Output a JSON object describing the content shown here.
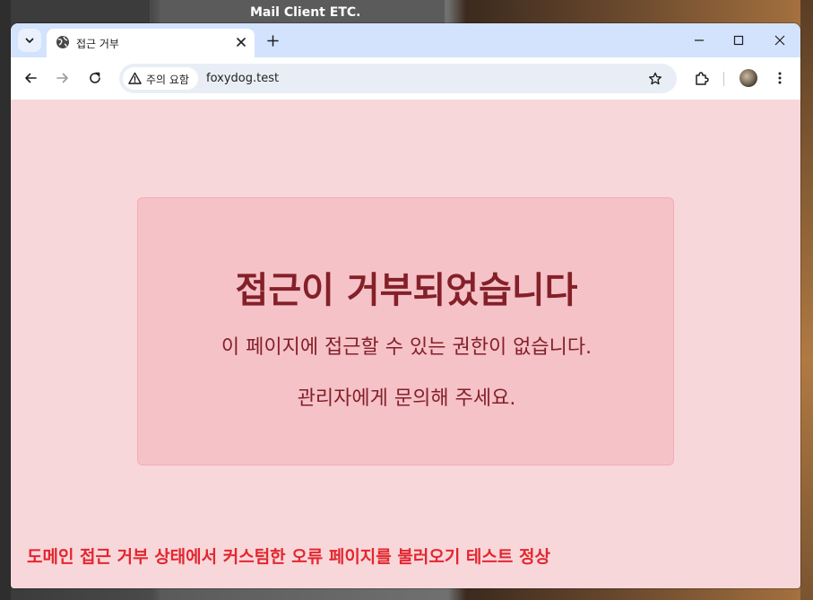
{
  "desktop": {
    "window_title": "Mail Client ETC."
  },
  "browser": {
    "tab": {
      "title": "접근 거부",
      "favicon": "globe-icon"
    },
    "omnibox": {
      "security_chip": "주의 요함",
      "url": "foxydog.test"
    },
    "colors": {
      "tabstrip": "#d3e3fd",
      "omnibox": "#e9eef6"
    }
  },
  "page": {
    "title": "접근이 거부되었습니다",
    "message": "이 페이지에 접근할 수 있는 권한이 없습니다.",
    "contact": "관리자에게 문의해 주세요.",
    "note": "도메인 접근 거부 상태에서 커스텀한 오류 페이지를 불러오기 테스트 정상",
    "colors": {
      "background": "#f8d7da",
      "card": "#f5c2c7",
      "text": "#842029",
      "note": "#e3262f"
    }
  }
}
